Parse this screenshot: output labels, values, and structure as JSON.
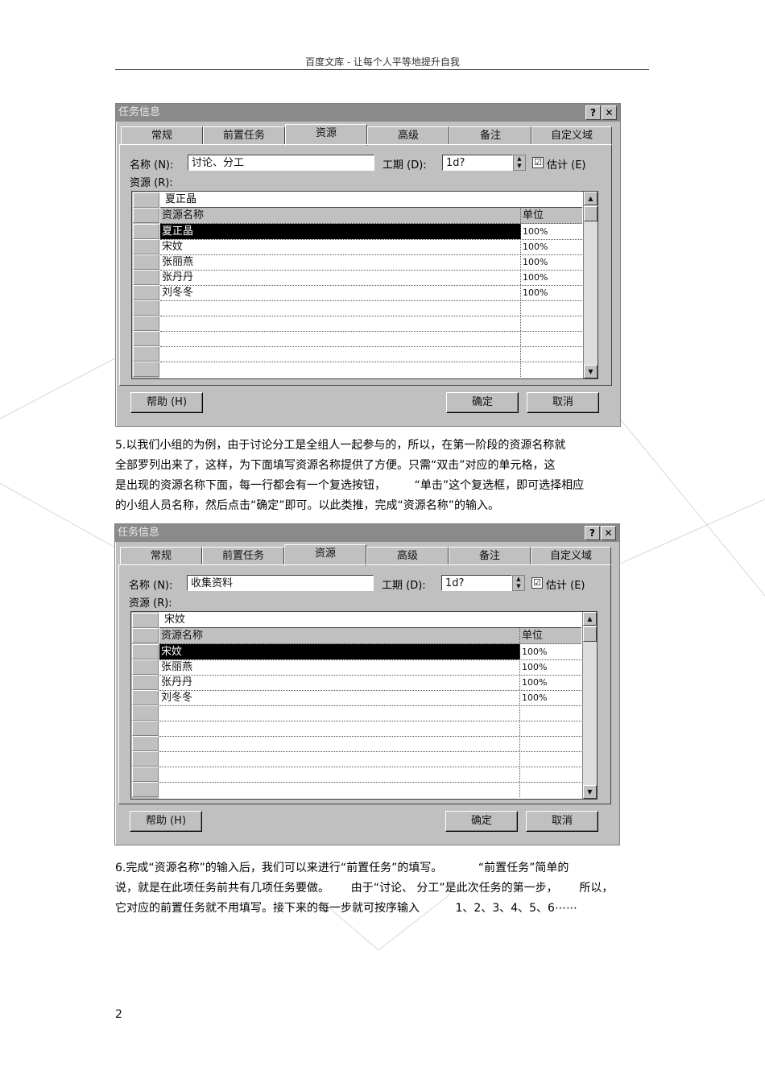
{
  "header": {
    "text": "百度文库  -  让每个人平等地提升自我"
  },
  "dialogs": [
    {
      "title": "任务信息",
      "help_btn": "?",
      "close_btn": "✕",
      "tabs": [
        "常规",
        "前置任务",
        "资源",
        "高级",
        "备注",
        "自定义域"
      ],
      "active_tab": "资源",
      "name_label": "名称 (N):",
      "name_value": "讨论、分工",
      "duration_label": "工期 (D):",
      "duration_value": "1d?",
      "estimate_label": "估计 (E)",
      "estimate_checked": "☑",
      "resources_label": "资源 (R):",
      "edit_value": "夏正晶",
      "col_name": "资源名称",
      "col_unit": "单位",
      "rows": [
        {
          "name": "夏正晶",
          "unit": "100%"
        },
        {
          "name": "宋妏",
          "unit": "100%"
        },
        {
          "name": "张丽燕",
          "unit": "100%"
        },
        {
          "name": "张丹丹",
          "unit": "100%"
        },
        {
          "name": "刘冬冬",
          "unit": "100%"
        }
      ],
      "help_button": "帮助 (H)",
      "ok_button": "确定",
      "cancel_button": "取消"
    },
    {
      "title": "任务信息",
      "help_btn": "?",
      "close_btn": "✕",
      "tabs": [
        "常规",
        "前置任务",
        "资源",
        "高级",
        "备注",
        "自定义域"
      ],
      "active_tab": "资源",
      "name_label": "名称 (N):",
      "name_value": "收集资料",
      "duration_label": "工期 (D):",
      "duration_value": "1d?",
      "estimate_label": "估计 (E)",
      "estimate_checked": "☑",
      "resources_label": "资源 (R):",
      "edit_value": "宋妏",
      "col_name": "资源名称",
      "col_unit": "单位",
      "rows": [
        {
          "name": "宋妏",
          "unit": "100%"
        },
        {
          "name": "张丽燕",
          "unit": "100%"
        },
        {
          "name": "张丹丹",
          "unit": "100%"
        },
        {
          "name": "刘冬冬",
          "unit": "100%"
        }
      ],
      "help_button": "帮助 (H)",
      "ok_button": "确定",
      "cancel_button": "取消"
    }
  ],
  "paragraph5": [
    "5.以我们小组的为例，由于讨论分工是全组人一起参与的，所以，在第一阶段的资源名称就",
    "全部罗列出来了，这样，为下面填写资源名称提供了方便。只需“双击”对应的单元格，这",
    "是出现的资源名称下面，每一行都会有一个复选按钮，        “单击”这个复选框，即可选择相应",
    "的小组人员名称，然后点击“确定”即可。以此类推，完成“资源名称”的输入。"
  ],
  "paragraph6": [
    "6.完成“资源名称”的输入后，我们可以来进行“前置任务”的填写。          “前置任务”简单的",
    "说，就是在此项任务前共有几项任务要做。      由于“讨论、 分工”是此次任务的第一步，      所以，",
    "它对应的前置任务就不用填写。接下来的每一步就可按序输入          1、2、3、4、5、6⋯⋯"
  ],
  "page_number": "2"
}
